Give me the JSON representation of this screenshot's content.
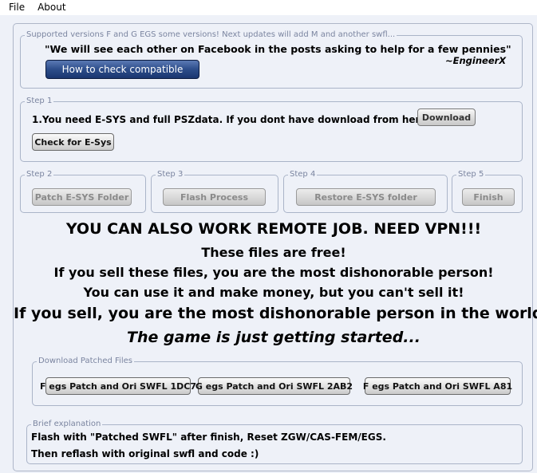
{
  "menu": {
    "file": "File",
    "about": "About"
  },
  "supported": {
    "legend": "Supported versions F and G EGS some versions! Next updates will add M and another swfl...",
    "quote": "\"We will see each other on Facebook in the posts asking to help for a few pennies\"",
    "signature": "~EngineerX",
    "check_button": "How to check compatible"
  },
  "step1": {
    "legend": "Step 1",
    "text": "1.You need E-SYS and full PSZdata. If you dont have download from here!",
    "download_button": "Download",
    "check_esys_button": "Check for E-Sys"
  },
  "step2": {
    "legend": "Step 2",
    "button": "Patch E-SYS Folder"
  },
  "step3": {
    "legend": "Step 3",
    "button": "Flash Process"
  },
  "step4": {
    "legend": "Step 4",
    "button": "Restore E-SYS folder"
  },
  "step5": {
    "legend": "Step 5",
    "button": "Finish"
  },
  "messages": {
    "remote": "YOU CAN ALSO WORK REMOTE JOB. NEED VPN!!!",
    "free": "These files are free!",
    "sell_warning": "If you sell these files, you are the most dishonorable person!",
    "use_money": "You can use it and make money, but you can't sell it!",
    "sell_world": "If you sell, you are the most dishonorable person in the world!",
    "game": "The game is just getting started..."
  },
  "downloads": {
    "legend": "Download Patched Files",
    "buttons": [
      "F egs Patch and Ori SWFL 1DC7",
      "G egs Patch and Ori SWFL 2AB2",
      "F egs Patch and Ori SWFL A81"
    ]
  },
  "brief": {
    "legend": "Brief explanation",
    "line1": "Flash with \"Patched SWFL\" after finish, Reset ZGW/CAS-FEM/EGS.",
    "line2": "Then reflash with original swfl and code :)"
  }
}
